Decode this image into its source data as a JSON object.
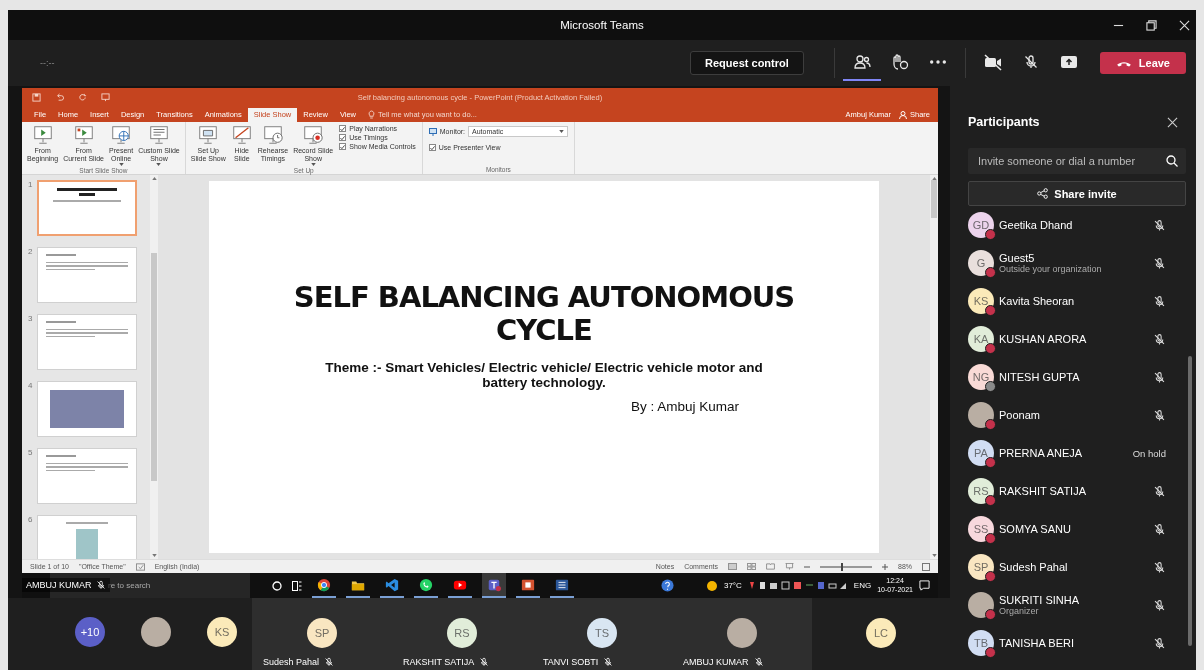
{
  "window": {
    "title": "Microsoft Teams"
  },
  "meeting_bar": {
    "timer": "--:--",
    "request_control": "Request control",
    "roster_selected": true,
    "leave": "Leave"
  },
  "shared_screen": {
    "presenter_label": "AMBUJ KUMAR",
    "presenter_muted": true,
    "powerpoint": {
      "title": "Self balancing autonomous cycle - PowerPoint (Product Activation Failed)",
      "tabs": [
        {
          "label": "File",
          "selected": false
        },
        {
          "label": "Home",
          "selected": false
        },
        {
          "label": "Insert",
          "selected": false
        },
        {
          "label": "Design",
          "selected": false
        },
        {
          "label": "Transitions",
          "selected": false
        },
        {
          "label": "Animations",
          "selected": false
        },
        {
          "label": "Slide Show",
          "selected": true
        },
        {
          "label": "Review",
          "selected": false
        },
        {
          "label": "View",
          "selected": false
        }
      ],
      "tell_me": "Tell me what you want to do...",
      "user": "Ambuj Kumar",
      "share": "Share",
      "ribbon_groups": [
        {
          "label": "Start Slide Show",
          "controls": [
            {
              "kind": "button",
              "lines": [
                "From",
                "Beginning"
              ],
              "dropdown": false
            },
            {
              "kind": "button",
              "lines": [
                "From",
                "Current Slide"
              ],
              "dropdown": false
            },
            {
              "kind": "button",
              "lines": [
                "Present",
                "Online"
              ],
              "dropdown": true
            },
            {
              "kind": "button",
              "lines": [
                "Custom Slide",
                "Show"
              ],
              "dropdown": true
            }
          ]
        },
        {
          "label": "Set Up",
          "controls": [
            {
              "kind": "button",
              "lines": [
                "Set Up",
                "Slide Show"
              ],
              "dropdown": false
            },
            {
              "kind": "button",
              "lines": [
                "Hide",
                "Slide"
              ],
              "dropdown": false
            },
            {
              "kind": "button",
              "lines": [
                "Rehearse",
                "Timings"
              ],
              "dropdown": false
            },
            {
              "kind": "button",
              "lines": [
                "Record Slide",
                "Show"
              ],
              "dropdown": true
            },
            {
              "kind": "checklist",
              "items": [
                {
                  "label": "Play Narrations",
                  "checked": true
                },
                {
                  "label": "Use Timings",
                  "checked": true
                },
                {
                  "label": "Show Media Controls",
                  "checked": true
                }
              ]
            }
          ]
        },
        {
          "label": "Monitors",
          "controls": [
            {
              "kind": "monitor",
              "label": "Monitor:",
              "value": "Automatic"
            },
            {
              "kind": "checkbox",
              "label": "Use Presenter View",
              "checked": true
            }
          ]
        }
      ],
      "slides": [
        {
          "number": "1",
          "kind": "title",
          "selected": true
        },
        {
          "number": "2",
          "kind": "text",
          "selected": false
        },
        {
          "number": "3",
          "kind": "text",
          "selected": false
        },
        {
          "number": "4",
          "kind": "picture",
          "selected": false
        },
        {
          "number": "5",
          "kind": "text",
          "selected": false
        },
        {
          "number": "6",
          "kind": "figure",
          "selected": false
        }
      ],
      "slide": {
        "title": "SELF BALANCING AUTONOMOUS CYCLE",
        "subtitle": "Theme :- Smart Vehicles/ Electric vehicle/ Electric vehicle motor and battery technology.",
        "author": "By : Ambuj Kumar"
      },
      "status_bar": {
        "slide_info": "Slide 1 of 10",
        "theme": "\"Office Theme\"",
        "language": "English (India)",
        "notes": "Notes",
        "comments": "Comments",
        "zoom": {
          "level": 0.4,
          "reading": "88%"
        }
      }
    },
    "taskbar": {
      "search": "re to search",
      "apps": [
        {
          "selected": false
        },
        {
          "selected": false
        },
        {
          "selected": false
        },
        {
          "selected": false
        },
        {
          "selected": false
        },
        {
          "selected": true
        },
        {
          "selected": false
        },
        {
          "selected": false
        }
      ],
      "temperature": "37°C",
      "language": "ENG",
      "time": "12:24",
      "date": "10-07-2021"
    }
  },
  "participants": {
    "title": "Participants",
    "search_placeholder": "Invite someone or dial a number",
    "share_invite": "Share invite",
    "people": [
      {
        "kind": "initials",
        "initials": "GD",
        "color": "#ecd3ec",
        "name": "Geetika Dhand",
        "busy": true,
        "muted": true
      },
      {
        "kind": "initials",
        "initials": "G",
        "color": "#e9dfdc",
        "name": "Guest5",
        "subtitle": "Outside your organization",
        "busy": true,
        "muted": true
      },
      {
        "kind": "initials",
        "initials": "KS",
        "color": "#fbeab9",
        "name": "Kavita Sheoran",
        "busy": true,
        "muted": true
      },
      {
        "kind": "initials",
        "initials": "KA",
        "color": "#e1edd9",
        "name": "KUSHAN ARORA",
        "busy": true,
        "muted": true
      },
      {
        "kind": "initials",
        "initials": "NG",
        "color": "#f9dad6",
        "name": "NITESH GUPTA",
        "busy": false,
        "muted": true
      },
      {
        "kind": "photo",
        "name": "Poonam",
        "busy": true,
        "muted": true
      },
      {
        "kind": "initials",
        "initials": "PA",
        "color": "#d1ddf3",
        "name": "PRERNA ANEJA",
        "busy": true,
        "muted": false,
        "status_label": "On hold"
      },
      {
        "kind": "initials",
        "initials": "RS",
        "color": "#e1edd9",
        "name": "RAKSHIT SATIJA",
        "busy": true,
        "muted": true
      },
      {
        "kind": "initials",
        "initials": "SS",
        "color": "#f7d8dd",
        "name": "SOMYA SANU",
        "busy": true,
        "muted": true
      },
      {
        "kind": "initials",
        "initials": "SP",
        "color": "#f9e6c1",
        "name": "Sudesh Pahal",
        "busy": true,
        "muted": true
      },
      {
        "kind": "photo",
        "name": "SUKRITI SINHA",
        "subtitle": "Organizer",
        "busy": true,
        "muted": true
      },
      {
        "kind": "initials",
        "initials": "TB",
        "color": "#d1ddf3",
        "name": "TANISHA BERI",
        "busy": true,
        "muted": true
      }
    ]
  },
  "video_strip": {
    "others_count": "+10",
    "avatars": [
      {
        "kind": "photo"
      },
      {
        "kind": "initials",
        "initials": "KS",
        "color": "#fbeab9"
      }
    ],
    "tiles": [
      {
        "kind": "initials",
        "initials": "SP",
        "color": "#f9e6c1",
        "name": "Sudesh Pahal",
        "muted": true
      },
      {
        "kind": "initials",
        "initials": "RS",
        "color": "#e1edd9",
        "name": "RAKSHIT SATIJA",
        "muted": true
      },
      {
        "kind": "initials",
        "initials": "TS",
        "color": "#d9e6f2",
        "name": "TANVI SOBTI",
        "muted": true
      },
      {
        "kind": "photo",
        "name": "AMBUJ KUMAR",
        "muted": true
      },
      {
        "kind": "initials",
        "initials": "LC",
        "color": "#fbeab9"
      }
    ]
  }
}
